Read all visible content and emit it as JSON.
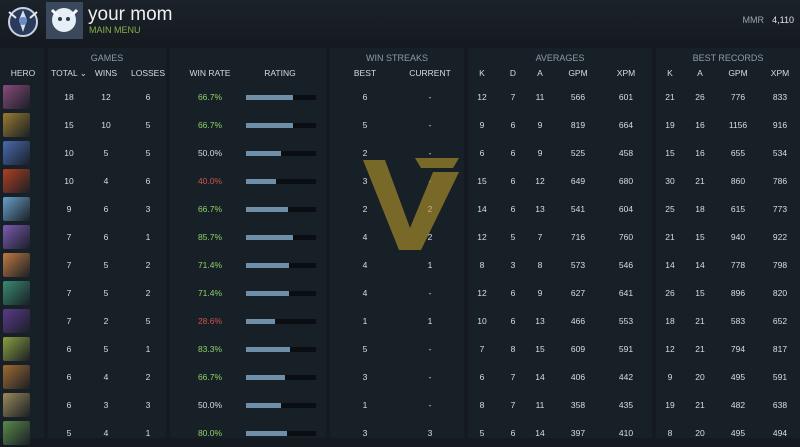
{
  "header": {
    "username": "your mom",
    "main_menu": "MAIN MENU",
    "mmr_label": "MMR",
    "mmr_value": "4,110"
  },
  "groups": {
    "games": "GAMES",
    "win_streaks": "WIN STREAKS",
    "averages": "AVERAGES",
    "best_records": "BEST RECORDS"
  },
  "columns": {
    "hero": "HERO",
    "total": "TOTAL",
    "sort_arrow": "⌄",
    "wins": "WINS",
    "losses": "LOSSES",
    "win_rate": "WIN RATE",
    "rating": "RATING",
    "best": "BEST",
    "current": "CURRENT",
    "k": "K",
    "d": "D",
    "a": "A",
    "gpm": "GPM",
    "xpm": "XPM",
    "best_k": "K",
    "best_a": "A",
    "best_gpm": "GPM",
    "best_xpm": "XPM"
  },
  "colors": {
    "win_rate_green": "#8ed16a",
    "win_rate_red": "#d0524a",
    "rating_bar": "#6f8fa8",
    "background": "#141a20"
  },
  "rows": [
    {
      "portrait": "#8a4a7a",
      "total": "18",
      "wins": "12",
      "losses": "6",
      "win_rate": "66.7%",
      "rating": 0.67,
      "best": "6",
      "current": "-",
      "k": "12",
      "d": "7",
      "a": "11",
      "gpm": "566",
      "xpm": "601",
      "bk": "21",
      "ba": "26",
      "bgpm": "776",
      "bxpm": "833"
    },
    {
      "portrait": "#9a7a30",
      "total": "15",
      "wins": "10",
      "losses": "5",
      "win_rate": "66.7%",
      "rating": 0.67,
      "best": "5",
      "current": "-",
      "k": "9",
      "d": "6",
      "a": "9",
      "gpm": "819",
      "xpm": "664",
      "bk": "19",
      "ba": "16",
      "bgpm": "1156",
      "bxpm": "916"
    },
    {
      "portrait": "#4a6ab0",
      "total": "10",
      "wins": "5",
      "losses": "5",
      "win_rate": "50.0%",
      "rating": 0.5,
      "best": "2",
      "current": "-",
      "k": "6",
      "d": "6",
      "a": "9",
      "gpm": "525",
      "xpm": "458",
      "bk": "15",
      "ba": "16",
      "bgpm": "655",
      "bxpm": "534"
    },
    {
      "portrait": "#b04020",
      "total": "10",
      "wins": "4",
      "losses": "6",
      "win_rate": "40.0%",
      "rating": 0.43,
      "best": "3",
      "current": "-",
      "k": "15",
      "d": "6",
      "a": "12",
      "gpm": "649",
      "xpm": "680",
      "bk": "30",
      "ba": "21",
      "bgpm": "860",
      "bxpm": "786"
    },
    {
      "portrait": "#6aa0c8",
      "total": "9",
      "wins": "6",
      "losses": "3",
      "win_rate": "66.7%",
      "rating": 0.6,
      "best": "2",
      "current": "2",
      "k": "14",
      "d": "6",
      "a": "13",
      "gpm": "541",
      "xpm": "604",
      "bk": "25",
      "ba": "18",
      "bgpm": "615",
      "bxpm": "773"
    },
    {
      "portrait": "#7a5ab0",
      "total": "7",
      "wins": "6",
      "losses": "1",
      "win_rate": "85.7%",
      "rating": 0.67,
      "best": "4",
      "current": "2",
      "k": "12",
      "d": "5",
      "a": "7",
      "gpm": "716",
      "xpm": "760",
      "bk": "21",
      "ba": "15",
      "bgpm": "940",
      "bxpm": "922"
    },
    {
      "portrait": "#c07a40",
      "total": "7",
      "wins": "5",
      "losses": "2",
      "win_rate": "71.4%",
      "rating": 0.61,
      "best": "4",
      "current": "1",
      "k": "8",
      "d": "3",
      "a": "8",
      "gpm": "573",
      "xpm": "546",
      "bk": "14",
      "ba": "14",
      "bgpm": "778",
      "bxpm": "798"
    },
    {
      "portrait": "#3a8a70",
      "total": "7",
      "wins": "5",
      "losses": "2",
      "win_rate": "71.4%",
      "rating": 0.61,
      "best": "4",
      "current": "-",
      "k": "12",
      "d": "6",
      "a": "9",
      "gpm": "627",
      "xpm": "641",
      "bk": "26",
      "ba": "15",
      "bgpm": "896",
      "bxpm": "820"
    },
    {
      "portrait": "#5a3a8a",
      "total": "7",
      "wins": "2",
      "losses": "5",
      "win_rate": "28.6%",
      "rating": 0.41,
      "best": "1",
      "current": "1",
      "k": "10",
      "d": "6",
      "a": "13",
      "gpm": "466",
      "xpm": "553",
      "bk": "18",
      "ba": "21",
      "bgpm": "583",
      "bxpm": "652"
    },
    {
      "portrait": "#8aa040",
      "total": "6",
      "wins": "5",
      "losses": "1",
      "win_rate": "83.3%",
      "rating": 0.63,
      "best": "5",
      "current": "-",
      "k": "7",
      "d": "8",
      "a": "15",
      "gpm": "609",
      "xpm": "591",
      "bk": "12",
      "ba": "21",
      "bgpm": "794",
      "bxpm": "817"
    },
    {
      "portrait": "#a06a30",
      "total": "6",
      "wins": "4",
      "losses": "2",
      "win_rate": "66.7%",
      "rating": 0.56,
      "best": "3",
      "current": "-",
      "k": "6",
      "d": "7",
      "a": "14",
      "gpm": "406",
      "xpm": "442",
      "bk": "9",
      "ba": "20",
      "bgpm": "495",
      "bxpm": "591"
    },
    {
      "portrait": "#9a8a5a",
      "total": "6",
      "wins": "3",
      "losses": "3",
      "win_rate": "50.0%",
      "rating": 0.5,
      "best": "1",
      "current": "-",
      "k": "8",
      "d": "7",
      "a": "11",
      "gpm": "358",
      "xpm": "435",
      "bk": "19",
      "ba": "21",
      "bgpm": "482",
      "bxpm": "638"
    },
    {
      "portrait": "#5a8a4a",
      "total": "5",
      "wins": "4",
      "losses": "1",
      "win_rate": "80.0%",
      "rating": 0.59,
      "best": "3",
      "current": "3",
      "k": "5",
      "d": "6",
      "a": "14",
      "gpm": "397",
      "xpm": "410",
      "bk": "8",
      "ba": "20",
      "bgpm": "495",
      "bxpm": "494"
    }
  ]
}
